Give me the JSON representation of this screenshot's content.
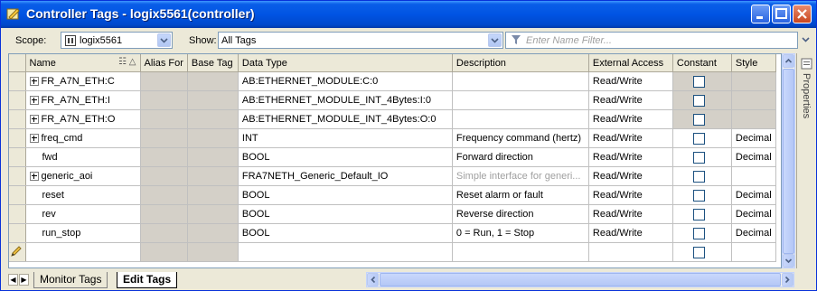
{
  "window": {
    "title": "Controller Tags - logix5561(controller)"
  },
  "toolbar": {
    "scope_label": "Scope:",
    "scope_value": "logix5561",
    "show_label": "Show:",
    "show_value": "All Tags",
    "filter_placeholder": "Enter Name Filter..."
  },
  "columns": {
    "name": "Name",
    "alias_for": "Alias For",
    "base_tag": "Base Tag",
    "data_type": "Data Type",
    "description": "Description",
    "external_access": "External Access",
    "constant": "Constant",
    "style": "Style"
  },
  "rows": [
    {
      "name": "FR_A7N_ETH:C",
      "alias_for": "",
      "base_tag": "",
      "data_type": "AB:ETHERNET_MODULE:C:0",
      "description": "",
      "external_access": "Read/Write",
      "constant": false,
      "style": "",
      "expandable": true,
      "module": true
    },
    {
      "name": "FR_A7N_ETH:I",
      "alias_for": "",
      "base_tag": "",
      "data_type": "AB:ETHERNET_MODULE_INT_4Bytes:I:0",
      "description": "",
      "external_access": "Read/Write",
      "constant": false,
      "style": "",
      "expandable": true,
      "module": true
    },
    {
      "name": "FR_A7N_ETH:O",
      "alias_for": "",
      "base_tag": "",
      "data_type": "AB:ETHERNET_MODULE_INT_4Bytes:O:0",
      "description": "",
      "external_access": "Read/Write",
      "constant": false,
      "style": "",
      "expandable": true,
      "module": true
    },
    {
      "name": "freq_cmd",
      "alias_for": "",
      "base_tag": "",
      "data_type": "INT",
      "description": "Frequency command (hertz)",
      "external_access": "Read/Write",
      "constant": false,
      "style": "Decimal",
      "expandable": true,
      "module": false
    },
    {
      "name": "fwd",
      "alias_for": "",
      "base_tag": "",
      "data_type": "BOOL",
      "description": "Forward direction",
      "external_access": "Read/Write",
      "constant": false,
      "style": "Decimal",
      "expandable": false,
      "module": false
    },
    {
      "name": "generic_aoi",
      "alias_for": "",
      "base_tag": "",
      "data_type": "FRA7NETH_Generic_Default_IO",
      "description": "Simple interface for generi...",
      "external_access": "Read/Write",
      "constant": false,
      "style": "",
      "expandable": true,
      "module": false,
      "desc_dim": true
    },
    {
      "name": "reset",
      "alias_for": "",
      "base_tag": "",
      "data_type": "BOOL",
      "description": "Reset alarm or fault",
      "external_access": "Read/Write",
      "constant": false,
      "style": "Decimal",
      "expandable": false,
      "module": false
    },
    {
      "name": "rev",
      "alias_for": "",
      "base_tag": "",
      "data_type": "BOOL",
      "description": "Reverse direction",
      "external_access": "Read/Write",
      "constant": false,
      "style": "Decimal",
      "expandable": false,
      "module": false
    },
    {
      "name": "run_stop",
      "alias_for": "",
      "base_tag": "",
      "data_type": "BOOL",
      "description": "0 = Run, 1 = Stop",
      "external_access": "Read/Write",
      "constant": false,
      "style": "Decimal",
      "expandable": false,
      "module": false
    }
  ],
  "side_panel": {
    "label": "Properties"
  },
  "tabs": [
    {
      "label": "Monitor Tags",
      "active": false
    },
    {
      "label": "Edit Tags",
      "active": true
    }
  ],
  "icons": {
    "window": "tag-window-icon",
    "scope": "controller-icon",
    "filter": "funnel-icon",
    "new_row": "pencil-icon"
  }
}
